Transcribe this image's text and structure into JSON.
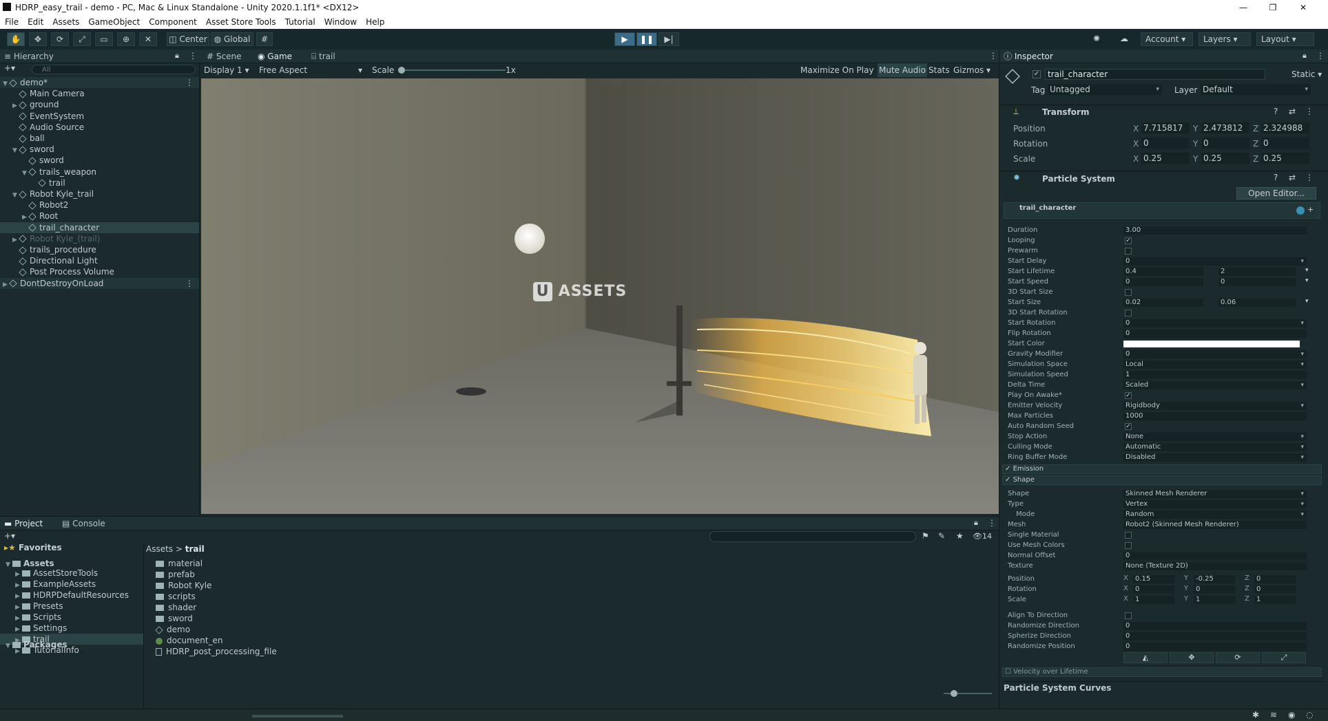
{
  "window": {
    "title": "HDRP_easy_trail - demo - PC, Mac & Linux Standalone - Unity 2020.1.1f1* <DX12>"
  },
  "menu": [
    "File",
    "Edit",
    "Assets",
    "GameObject",
    "Component",
    "Asset Store Tools",
    "Tutorial",
    "Window",
    "Help"
  ],
  "toolbar": {
    "center_label": "Center",
    "global_label": "Global",
    "account_label": "Account",
    "layers_label": "Layers",
    "layout_label": "Layout"
  },
  "hierarchy": {
    "tab_label": "Hierarchy",
    "search_placeholder": "All",
    "rows": [
      {
        "label": "demo*",
        "indent": 0,
        "arrow": "▼",
        "scene": true
      },
      {
        "label": "Main Camera",
        "indent": 1,
        "arrow": ""
      },
      {
        "label": "ground",
        "indent": 1,
        "arrow": "▶"
      },
      {
        "label": "EventSystem",
        "indent": 1,
        "arrow": ""
      },
      {
        "label": "Audio Source",
        "indent": 1,
        "arrow": ""
      },
      {
        "label": "ball",
        "indent": 1,
        "arrow": ""
      },
      {
        "label": "sword",
        "indent": 1,
        "arrow": "▼"
      },
      {
        "label": "sword",
        "indent": 2,
        "arrow": ""
      },
      {
        "label": "trails_weapon",
        "indent": 2,
        "arrow": "▼"
      },
      {
        "label": "trail",
        "indent": 3,
        "arrow": ""
      },
      {
        "label": "Robot Kyle_trail",
        "indent": 1,
        "arrow": "▼"
      },
      {
        "label": "Robot2",
        "indent": 2,
        "arrow": ""
      },
      {
        "label": "Root",
        "indent": 2,
        "arrow": "▶"
      },
      {
        "label": "trail_character",
        "indent": 2,
        "arrow": "",
        "selected": true
      },
      {
        "label": "Robot Kyle_(trail)",
        "indent": 1,
        "arrow": "▶",
        "disabled": true
      },
      {
        "label": "trails_procedure",
        "indent": 1,
        "arrow": ""
      },
      {
        "label": "Directional Light",
        "indent": 1,
        "arrow": ""
      },
      {
        "label": "Post Process Volume",
        "indent": 1,
        "arrow": ""
      },
      {
        "label": "DontDestroyOnLoad",
        "indent": 0,
        "arrow": "▶",
        "scene": true
      }
    ]
  },
  "game": {
    "tabs": [
      "Scene",
      "Game",
      "trail"
    ],
    "display": "Display 1",
    "aspect": "Free Aspect",
    "scale_label": "Scale",
    "scale_value": "1x",
    "maximize": "Maximize On Play",
    "mute": "Mute Audio",
    "stats": "Stats",
    "gizmos": "Gizmos",
    "watermark": "ASSETS",
    "watermark_mark": "U"
  },
  "project": {
    "tabs": [
      "Project",
      "Console"
    ],
    "favorites": "Favorites",
    "tree": [
      {
        "label": "Assets",
        "indent": 0,
        "bold": true
      },
      {
        "label": "AssetStoreTools",
        "indent": 1
      },
      {
        "label": "ExampleAssets",
        "indent": 1
      },
      {
        "label": "HDRPDefaultResources",
        "indent": 1
      },
      {
        "label": "Presets",
        "indent": 1
      },
      {
        "label": "Scripts",
        "indent": 1
      },
      {
        "label": "Settings",
        "indent": 1
      },
      {
        "label": "trail",
        "indent": 1,
        "selected": true
      },
      {
        "label": "TutorialInfo",
        "indent": 1
      },
      {
        "label": "Packages",
        "indent": 0,
        "bold": true
      }
    ],
    "breadcrumb": [
      "Assets",
      "trail"
    ],
    "files": [
      {
        "label": "material",
        "kind": "folder"
      },
      {
        "label": "prefab",
        "kind": "folder"
      },
      {
        "label": "Robot Kyle",
        "kind": "folder"
      },
      {
        "label": "scripts",
        "kind": "folder"
      },
      {
        "label": "shader",
        "kind": "folder"
      },
      {
        "label": "sword",
        "kind": "folder"
      },
      {
        "label": "demo",
        "kind": "scene"
      },
      {
        "label": "document_en",
        "kind": "doc"
      },
      {
        "label": "HDRP_post_processing_file",
        "kind": "asset"
      }
    ],
    "hidden_count": "14"
  },
  "inspector": {
    "tab_label": "Inspector",
    "object_name": "trail_character",
    "static_label": "Static",
    "tag_label": "Tag",
    "tag_value": "Untagged",
    "layer_label": "Layer",
    "layer_value": "Default",
    "transform": {
      "title": "Transform",
      "rows": [
        {
          "label": "Position",
          "x": "7.715817",
          "y": "2.473812",
          "z": "2.324988"
        },
        {
          "label": "Rotation",
          "x": "0",
          "y": "0",
          "z": "0"
        },
        {
          "label": "Scale",
          "x": "0.25",
          "y": "0.25",
          "z": "0.25"
        }
      ]
    },
    "particle": {
      "title": "Particle System",
      "open_editor": "Open Editor...",
      "system_name": "trail_character",
      "props": [
        {
          "label": "Duration",
          "value": "3.00"
        },
        {
          "label": "Looping",
          "check": true
        },
        {
          "label": "Prewarm",
          "check": false
        },
        {
          "label": "Start Delay",
          "value": "0",
          "drop": true
        },
        {
          "label": "Start Lifetime",
          "value": "0.4",
          "value2": "2",
          "drop": true
        },
        {
          "label": "Start Speed",
          "value": "0",
          "value2": "0",
          "drop": true
        },
        {
          "label": "3D Start Size",
          "check": false
        },
        {
          "label": "Start Size",
          "value": "0.02",
          "value2": "0.06",
          "drop": true
        },
        {
          "label": "3D Start Rotation",
          "check": false
        },
        {
          "label": "Start Rotation",
          "value": "0",
          "drop": true
        },
        {
          "label": "Flip Rotation",
          "value": "0"
        },
        {
          "label": "Start Color",
          "color": "#ffffff"
        },
        {
          "label": "Gravity Modifier",
          "value": "0",
          "drop": true
        },
        {
          "label": "Simulation Space",
          "value": "Local",
          "drop": true
        },
        {
          "label": "Simulation Speed",
          "value": "1"
        },
        {
          "label": "Delta Time",
          "value": "Scaled",
          "drop": true
        },
        {
          "label": "Play On Awake*",
          "check": true
        },
        {
          "label": "Emitter Velocity",
          "value": "Rigidbody",
          "drop": true
        },
        {
          "label": "Max Particles",
          "value": "1000"
        },
        {
          "label": "Auto Random Seed",
          "check": true
        },
        {
          "label": "Stop Action",
          "value": "None",
          "drop": true
        },
        {
          "label": "Culling Mode",
          "value": "Automatic",
          "drop": true
        },
        {
          "label": "Ring Buffer Mode",
          "value": "Disabled",
          "drop": true
        }
      ],
      "modules": [
        "Emission",
        "Shape"
      ],
      "shape_props": [
        {
          "label": "Shape",
          "value": "Skinned Mesh Renderer",
          "drop": true
        },
        {
          "label": "Type",
          "value": "Vertex",
          "drop": true
        },
        {
          "label": "Mode",
          "value": "Random",
          "drop": true,
          "indent": true
        },
        {
          "label": "Mesh",
          "value": "Robot2 (Skinned Mesh Renderer)"
        },
        {
          "label": "Single Material",
          "check": false
        },
        {
          "label": "Use Mesh Colors",
          "check": false
        },
        {
          "label": "Normal Offset",
          "value": "0"
        },
        {
          "label": "Texture",
          "value": "None (Texture 2D)"
        }
      ],
      "shape_transform": [
        {
          "label": "Position",
          "x": "0.15",
          "y": "-0.25",
          "z": "0"
        },
        {
          "label": "Rotation",
          "x": "0",
          "y": "0",
          "z": "0"
        },
        {
          "label": "Scale",
          "x": "1",
          "y": "1",
          "z": "1"
        }
      ],
      "shape_props2": [
        {
          "label": "Align To Direction",
          "check": false
        },
        {
          "label": "Randomize Direction",
          "value": "0"
        },
        {
          "label": "Spherize Direction",
          "value": "0"
        },
        {
          "label": "Randomize Position",
          "value": "0"
        }
      ],
      "velocity_module": "Velocity over Lifetime",
      "curves_label": "Particle System Curves"
    }
  }
}
